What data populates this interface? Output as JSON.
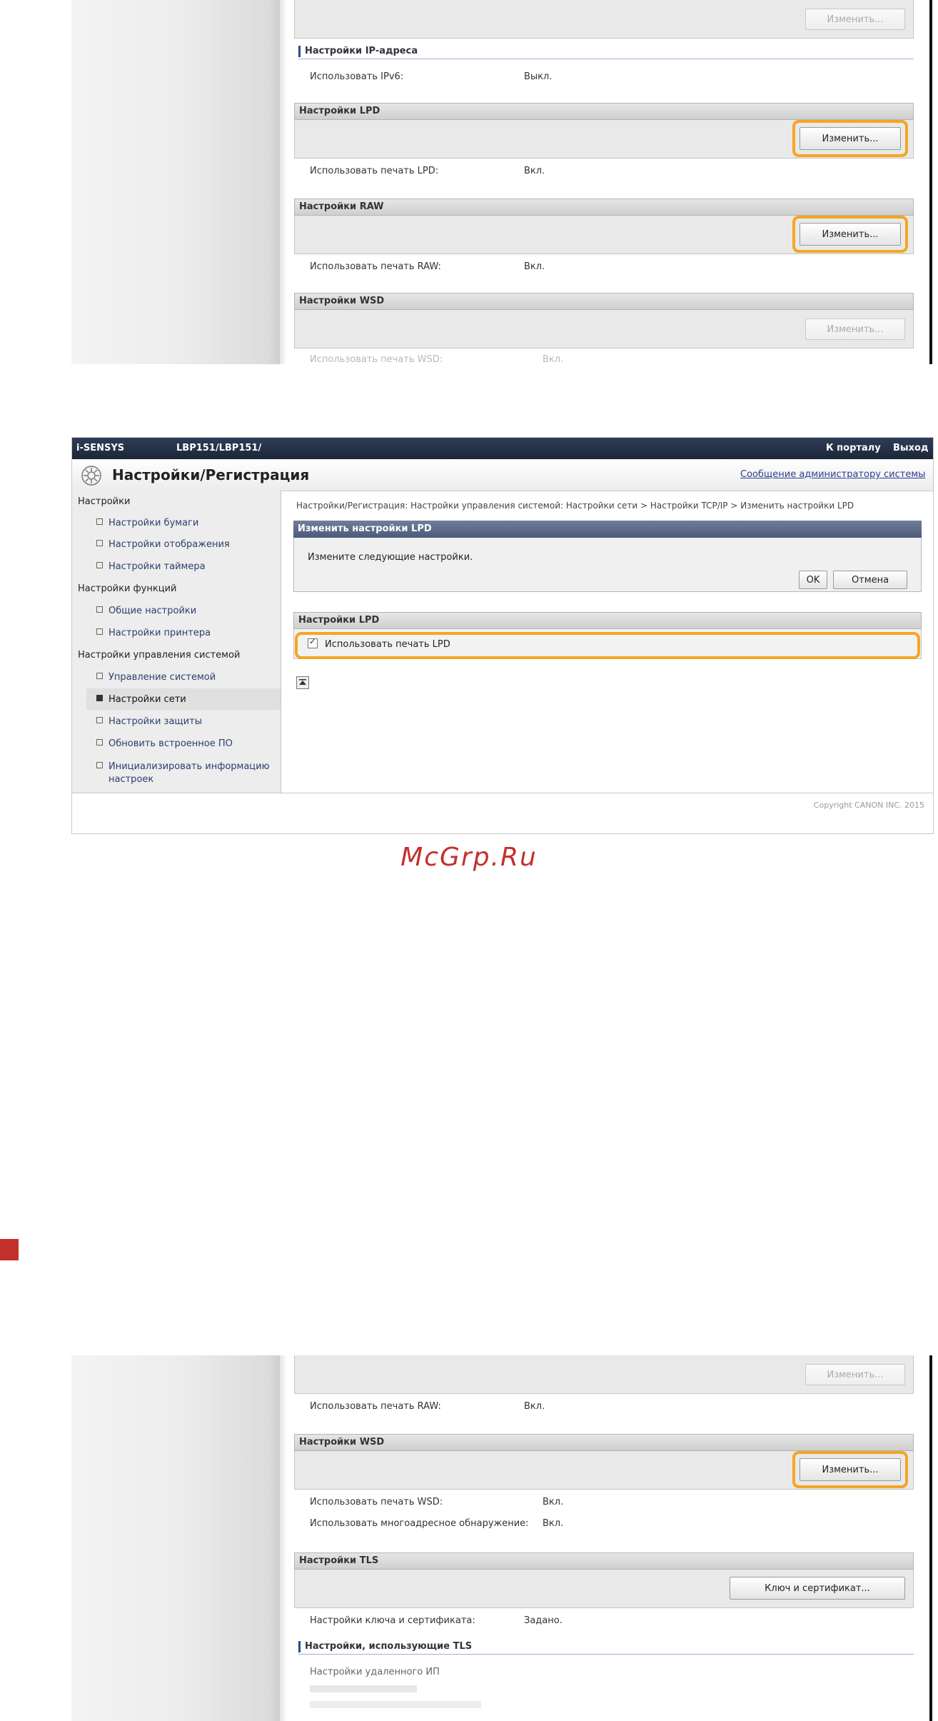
{
  "top_shot": {
    "change_label": "Изменить...",
    "ip_section": "Настройки IP-адреса",
    "ipv6_label": "Использовать IPv6:",
    "ipv6_value": "Выкл.",
    "lpd_header": "Настройки LPD",
    "lpd_label": "Использовать печать LPD:",
    "lpd_value": "Вкл.",
    "raw_header": "Настройки RAW",
    "raw_label": "Использовать печать RAW:",
    "raw_value": "Вкл.",
    "wsd_header": "Настройки WSD",
    "wsd_label_faded": "Использовать печать WSD:",
    "wsd_value_faded": "Вкл."
  },
  "middle_shot": {
    "brand": "i-SENSYS",
    "model": "LBP151/LBP151/",
    "portal_link": "К порталу",
    "logout_link": "Выход",
    "page_title": "Настройки/Регистрация",
    "admin_msg_link": "Сообщение администратору системы",
    "breadcrumb": "Настройки/Регистрация: Настройки управления системой: Настройки сети > Настройки TCP/IP > Изменить настройки LPD",
    "nav": {
      "group_settings": "Настройки",
      "paper": "Настройки бумаги",
      "display": "Настройки отображения",
      "timer": "Настройки таймера",
      "group_functions": "Настройки функций",
      "common": "Общие настройки",
      "printer": "Настройки принтера",
      "group_mgmt": "Настройки управления системой",
      "sys_mgmt": "Управление системой",
      "network": "Настройки сети",
      "security": "Настройки защиты",
      "firmware": "Обновить встроенное ПО",
      "init_line1": "Инициализировать информацию",
      "init_line2": "настроек"
    },
    "dialog_title": "Изменить настройки LPD",
    "dialog_msg": "Измените следующие настройки.",
    "ok_label": "OK",
    "cancel_label": "Отмена",
    "lpd_section": "Настройки LPD",
    "lpd_checkbox_label": "Использовать печать LPD",
    "copyright": "Copyright CANON INC. 2015"
  },
  "watermark": "McGrp.Ru",
  "bottom_shot": {
    "change_label": "Изменить...",
    "raw_label": "Использовать печать RAW:",
    "raw_value": "Вкл.",
    "wsd_header": "Настройки WSD",
    "wsd_label": "Использовать печать WSD:",
    "wsd_value": "Вкл.",
    "multicast_label": "Использовать многоадресное обнаружение:",
    "multicast_value": "Вкл.",
    "tls_header": "Настройки TLS",
    "key_cert_btn": "Ключ и сертификат...",
    "key_cert_label": "Настройки ключа и сертификата:",
    "key_cert_value": "Задано.",
    "tls_using": "Настройки, использующие TLS",
    "remote_ui": "Настройки удаленного ИП"
  }
}
